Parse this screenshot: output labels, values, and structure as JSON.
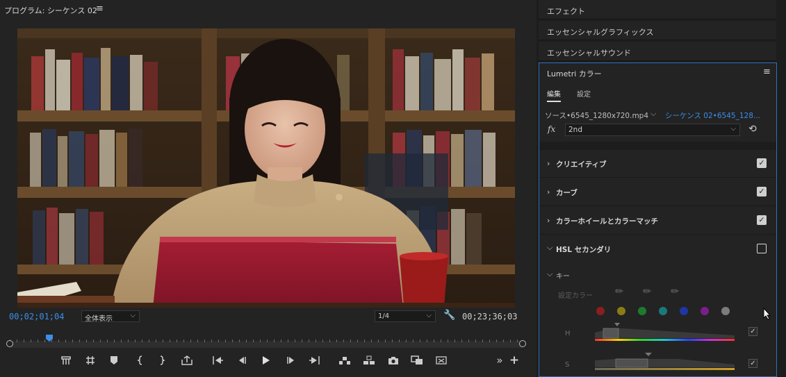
{
  "program": {
    "title": "プログラム: シーケンス 02",
    "menu_icon": "hamburger-icon",
    "current_timecode": "00;02;01;04",
    "zoom_value": "全体表示",
    "resolution_value": "1/4",
    "duration_timecode": "00;23;36;03"
  },
  "transport": {
    "buttons": [
      "marker-add-icon",
      "marker-clear-icon",
      "add-marker-icon",
      "mark-in-icon",
      "mark-out-icon",
      "export-frame-icon",
      "go-to-in-icon",
      "step-back-icon",
      "play-icon",
      "step-forward-icon",
      "go-to-out-icon",
      "lift-icon",
      "extract-icon",
      "camera-icon",
      "compare-icon",
      "vr-icon",
      "more-icon",
      "add-button-icon"
    ]
  },
  "panels": {
    "effects": "エフェクト",
    "essential_graphics": "エッセンシャルグラフィックス",
    "essential_sound": "エッセンシャルサウンド"
  },
  "lumetri": {
    "title": "Lumetri カラー",
    "tab_edit": "編集",
    "tab_settings": "設定",
    "source_label": "ソース•6545_1280x720.mp4",
    "sequence_label": "シーケンス 02•6545_128...",
    "fx_label": "fx",
    "effect_select": "2nd",
    "sections": [
      {
        "label": "クリエイティブ",
        "checked": true
      },
      {
        "label": "カーブ",
        "checked": true
      },
      {
        "label": "カラーホイールとカラーマッチ",
        "checked": true
      },
      {
        "label": "HSL セカンダリ",
        "checked": false
      }
    ],
    "key_label": "キー",
    "set_color_label": "設定カラー",
    "swatches": [
      "#8b1e1e",
      "#8b7d16",
      "#1e7a2e",
      "#1a7a7a",
      "#1e36a6",
      "#7a1e8b",
      "#7c7c7c"
    ],
    "h_label": "H",
    "s_label": "S"
  }
}
